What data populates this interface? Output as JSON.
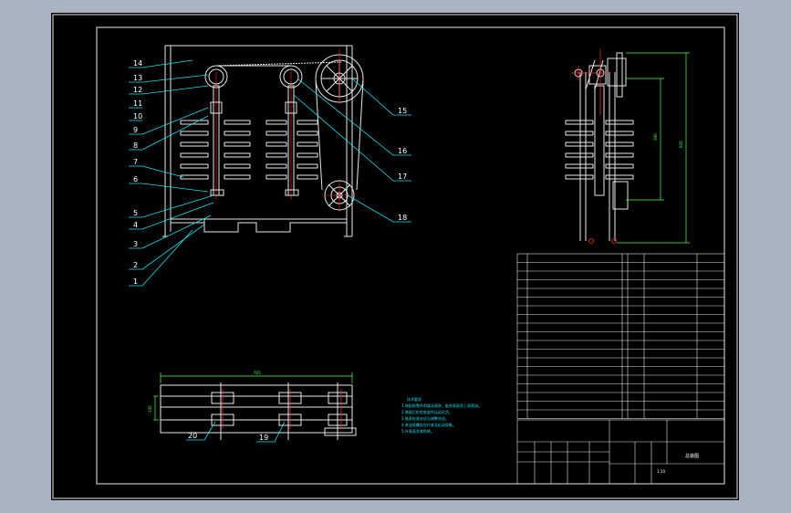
{
  "main_view": {
    "callouts_left": [
      "14",
      "13",
      "12",
      "11",
      "10",
      "9",
      "8",
      "7",
      "6",
      "5",
      "4",
      "3",
      "2",
      "1"
    ],
    "callouts_right": [
      "15",
      "16",
      "17",
      "18"
    ]
  },
  "side_view": {
    "dim_inner": "390",
    "dim_outer": "645"
  },
  "top_view": {
    "dim_width": "765",
    "dim_height": "140",
    "callouts": [
      "20",
      "19"
    ]
  },
  "notes": {
    "title": "技术要求",
    "lines": [
      "1.装配前零件用煤油清洗，配合表面涂上润滑油。",
      "2.装配后检验各部件运动灵活。",
      "3.链条松紧应适当调整合适。",
      "4.各连接螺栓应拧紧无松动现象。",
      "5.外表面涂漆防锈。"
    ]
  },
  "title_block": {
    "drawing_title": "总装图",
    "scale": "1:10"
  }
}
